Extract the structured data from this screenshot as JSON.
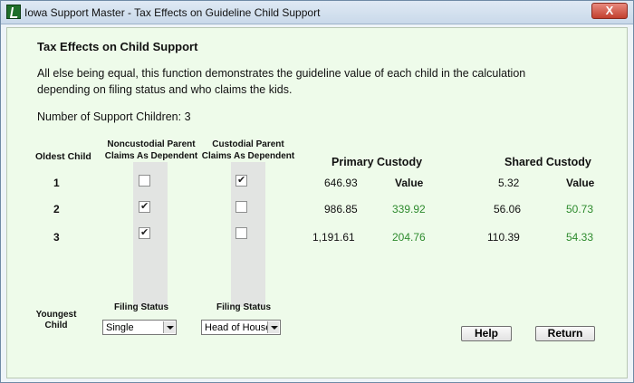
{
  "window": {
    "title": "Iowa Support Master - Tax Effects on Guideline Child Support",
    "close_label": "X"
  },
  "main": {
    "heading": "Tax Effects on Child Support",
    "description": "All else being equal, this function demonstrates the guideline value of each child in the calculation depending on filing status and who claims the kids.",
    "support_children_label": "Number of Support Children: 3"
  },
  "table": {
    "oldest_child_label": "Oldest Child",
    "youngest_child_label_line1": "Youngest",
    "youngest_child_label_line2": "Child",
    "noncustodial_header_line1": "Noncustodial Parent",
    "noncustodial_header_line2": "Claims As Dependent",
    "custodial_header_line1": "Custodial Parent",
    "custodial_header_line2": "Claims As Dependent",
    "primary_custody_header": "Primary Custody",
    "shared_custody_header": "Shared Custody",
    "rows": [
      {
        "child": "1",
        "noncustodial_checked": false,
        "custodial_checked": true,
        "primary_amount": "646.93",
        "primary_value": "Value",
        "shared_amount": "5.32",
        "shared_value": "Value"
      },
      {
        "child": "2",
        "noncustodial_checked": true,
        "custodial_checked": false,
        "primary_amount": "986.85",
        "primary_value": "339.92",
        "shared_amount": "56.06",
        "shared_value": "50.73"
      },
      {
        "child": "3",
        "noncustodial_checked": true,
        "custodial_checked": false,
        "primary_amount": "1,191.61",
        "primary_value": "204.76",
        "shared_amount": "110.39",
        "shared_value": "54.33"
      }
    ]
  },
  "filing": {
    "noncustodial_label": "Filing Status",
    "noncustodial_value": "Single",
    "custodial_label": "Filing Status",
    "custodial_value": "Head of House"
  },
  "buttons": {
    "help_label": "Help",
    "return_label": "Return"
  },
  "colors": {
    "value_green": "#2e8b2e",
    "client_background": "#eefbea"
  }
}
